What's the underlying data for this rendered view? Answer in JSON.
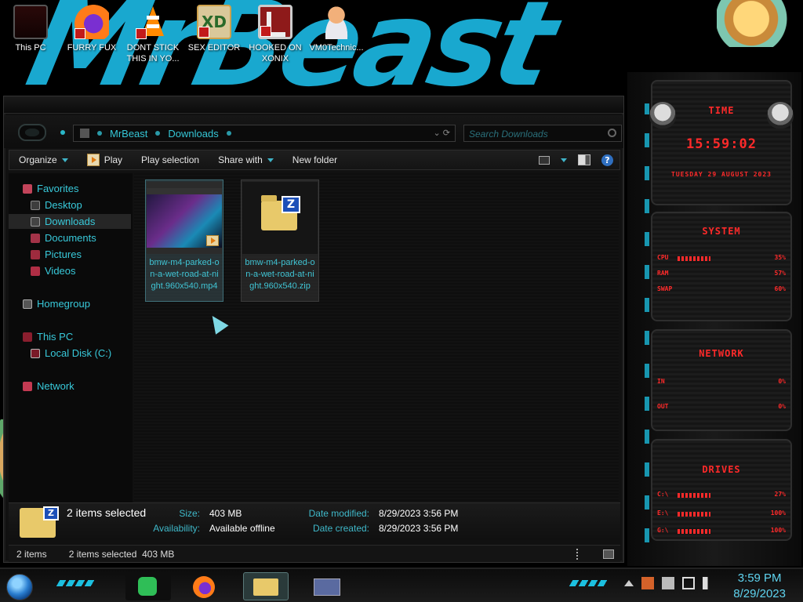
{
  "desktop": {
    "icons": [
      {
        "label": "This PC",
        "icon": "computer-icon"
      },
      {
        "label": "FURRY FUX",
        "icon": "firefox-icon"
      },
      {
        "label": "DONT STICK THIS IN YO...",
        "icon": "vlc-icon"
      },
      {
        "label": "SEX EDITOR",
        "icon": "xd-editor-icon"
      },
      {
        "label": "HOOKED ON XONIX",
        "icon": "xonix-game-icon"
      },
      {
        "label": "VM0Technic...",
        "icon": "doctor-icon"
      }
    ],
    "wallpaper_text": "MrBeast"
  },
  "explorer": {
    "breadcrumb": [
      "MrBeast",
      "Downloads"
    ],
    "search_placeholder": "Search Downloads",
    "commands": {
      "organize": "Organize",
      "play": "Play",
      "play_selection": "Play selection",
      "share_with": "Share with",
      "new_folder": "New folder"
    },
    "nav": {
      "favorites": "Favorites",
      "desktop": "Desktop",
      "downloads": "Downloads",
      "documents": "Documents",
      "pictures": "Pictures",
      "videos": "Videos",
      "homegroup": "Homegroup",
      "this_pc": "This PC",
      "local_disk": "Local Disk (C:)",
      "network": "Network"
    },
    "files": [
      {
        "name": "bmw-m4-parked-on-a-wet-road-at-night.960x540.mp4",
        "type": "video"
      },
      {
        "name": "bmw-m4-parked-on-a-wet-road-at-night.960x540.zip",
        "type": "zip"
      }
    ],
    "details": {
      "title": "2 items selected",
      "size_label": "Size:",
      "size": "403 MB",
      "availability_label": "Availability:",
      "availability": "Available offline",
      "modified_label": "Date modified:",
      "modified": "8/29/2023 3:56 PM",
      "created_label": "Date created:",
      "created": "8/29/2023 3:56 PM"
    },
    "status": {
      "items": "2 items",
      "selected": "2 items selected  403 MB"
    }
  },
  "gadgets": {
    "time": {
      "title": "TIME",
      "clock": "15:59:02",
      "date": "TUESDAY 29 AUGUST 2023"
    },
    "system": {
      "title": "SYSTEM",
      "rows": [
        {
          "label": "CPU",
          "value": "35%"
        },
        {
          "label": "RAM",
          "value": "57%"
        },
        {
          "label": "SWAP",
          "value": "60%"
        }
      ]
    },
    "network": {
      "title": "NETWORK",
      "rows": [
        {
          "label": "IN",
          "value": "0%"
        },
        {
          "label": "OUT",
          "value": "0%"
        }
      ]
    },
    "drives": {
      "title": "DRIVES",
      "rows": [
        {
          "label": "C:\\",
          "value": "27%"
        },
        {
          "label": "E:\\",
          "value": "100%"
        },
        {
          "label": "G:\\",
          "value": "100%"
        }
      ]
    }
  },
  "taskbar": {
    "time": "3:59 PM",
    "date": "8/29/2023"
  },
  "colors": {
    "accent": "#38c9da",
    "gadget_red": "#ff2a2a",
    "clock": "#5fd4f0"
  }
}
